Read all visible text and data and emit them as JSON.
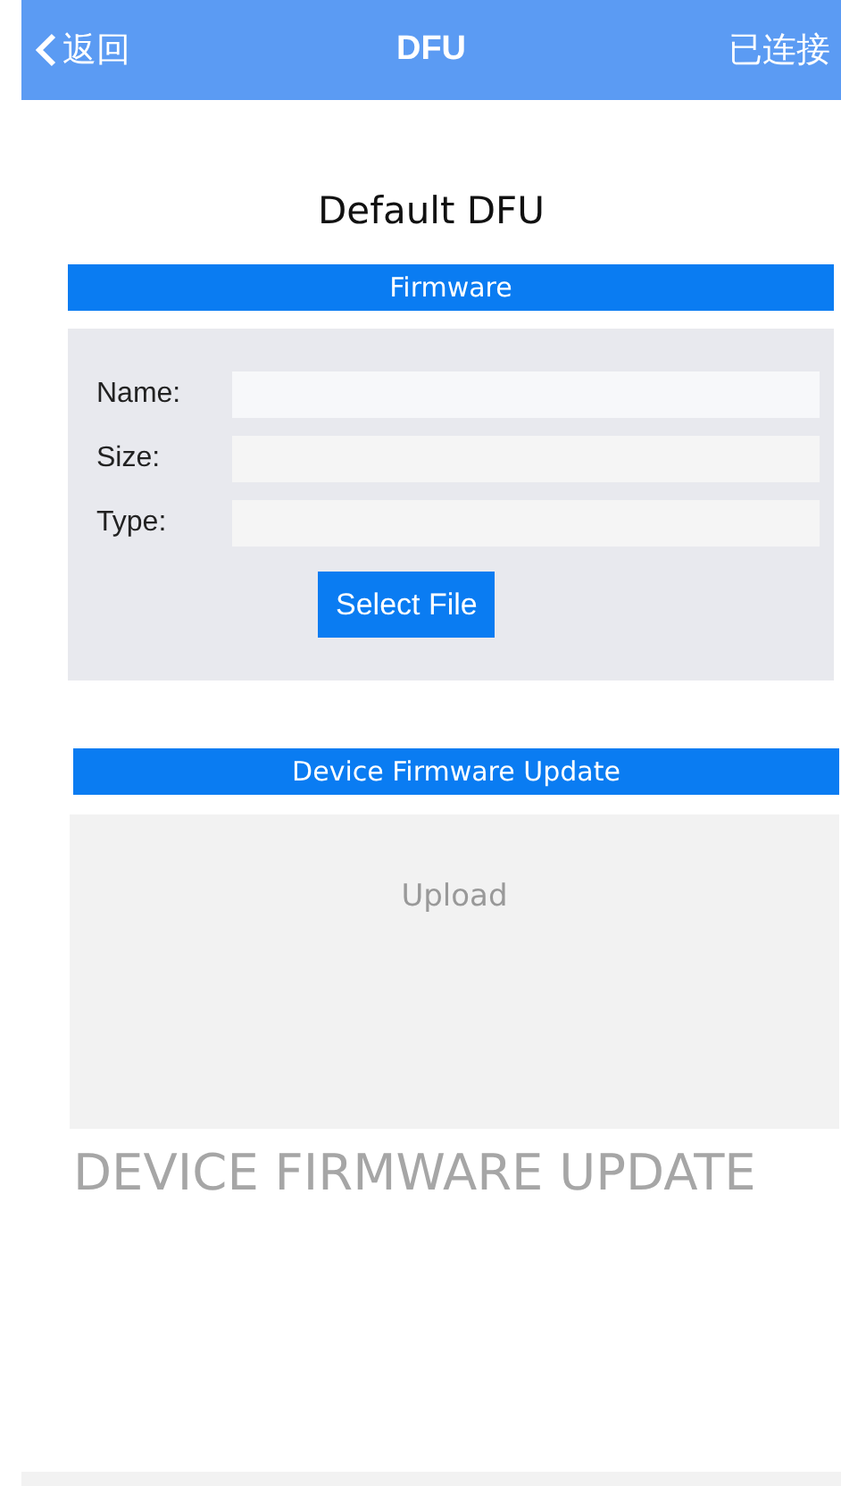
{
  "nav_bar": {
    "back": "返回",
    "title": "DFU",
    "status": "已连接"
  },
  "heading": "Default DFU",
  "firmware": {
    "title": "Firmware",
    "fields": [
      {
        "label": "Name:"
      },
      {
        "label": "Size:"
      },
      {
        "label": "Type:"
      }
    ],
    "button": "Select File"
  },
  "update": {
    "title": "Device Firmware Update",
    "upload": "Upload"
  },
  "banner": "DEVICE FIRMWARE UPDATE"
}
